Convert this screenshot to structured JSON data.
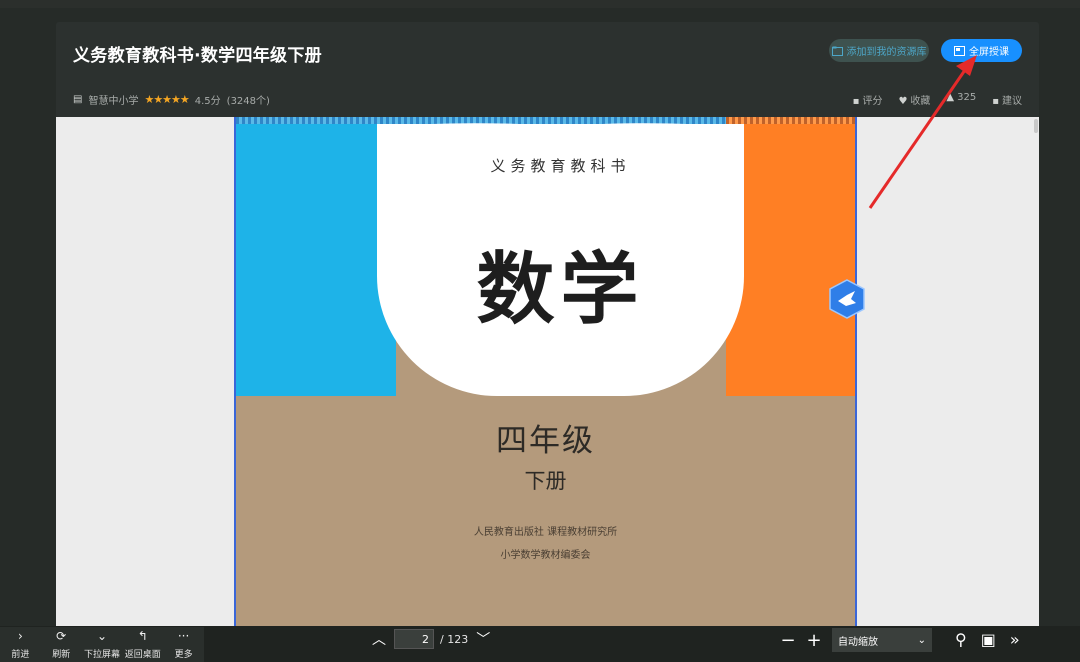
{
  "header": {
    "title": "义务教育教科书·数学四年级下册",
    "add_resource_label": "添加到我的资源库",
    "fullscreen_label": "全屏授课",
    "publisher_tag": "智慧中小学",
    "rating_stars": "★★★★★",
    "rating_value": "4.5分",
    "rating_count": "(3248个)",
    "actions": {
      "rate": "评分",
      "favorite": "收藏",
      "like_count": "325",
      "suggest": "建议"
    }
  },
  "book_cover": {
    "series": "义务教育教科书",
    "subject": "数学",
    "grade": "四年级",
    "volume": "下册",
    "publisher": "人民教育出版社  课程教材研究所",
    "editor": "小学数学教材编委会"
  },
  "bottom_left": {
    "items": [
      {
        "icon": "›",
        "label": "前进"
      },
      {
        "icon": "⟳",
        "label": "刷新"
      },
      {
        "icon": "⌄",
        "label": "下拉屏幕"
      },
      {
        "icon": "↰",
        "label": "返回桌面"
      },
      {
        "icon": "···",
        "label": "更多"
      }
    ]
  },
  "pager": {
    "current_page": "2",
    "total_pages": "/ 123",
    "prev_icon": "︿",
    "next_icon": "﹀"
  },
  "zoom": {
    "minus": "−",
    "plus": "+",
    "mode": "自动缩放",
    "caret": "⌄"
  },
  "tools": {
    "search_icon": "⚲",
    "present_icon": "▣",
    "more_icon": "»"
  },
  "colors": {
    "accent_blue": "#1890ff",
    "cover_blue": "#1eb3e8",
    "cover_orange": "#ff7f24",
    "cover_tan": "#b49a7c",
    "star": "#f5a623",
    "arrow_red": "#e52a2a"
  }
}
